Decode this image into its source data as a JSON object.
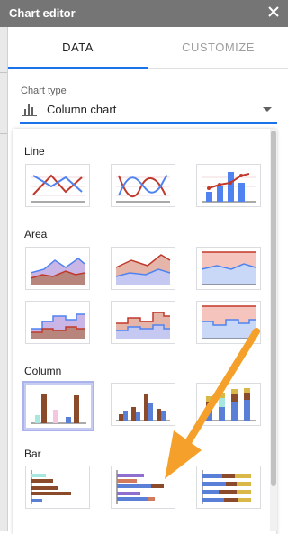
{
  "editor": {
    "title": "Chart editor",
    "close_icon": "close-icon"
  },
  "tabs": [
    {
      "label": "DATA",
      "active": true
    },
    {
      "label": "CUSTOMIZE",
      "active": false
    }
  ],
  "chart_type": {
    "label": "Chart type",
    "value": "Column chart",
    "icon": "column-chart-icon"
  },
  "sections": {
    "line": "Line",
    "area": "Area",
    "column": "Column",
    "bar": "Bar"
  },
  "colors": {
    "accent": "#1a73e8",
    "series_blue": "#4f83f0",
    "series_red": "#c0392b",
    "annotation_arrow": "#f5a02a"
  }
}
